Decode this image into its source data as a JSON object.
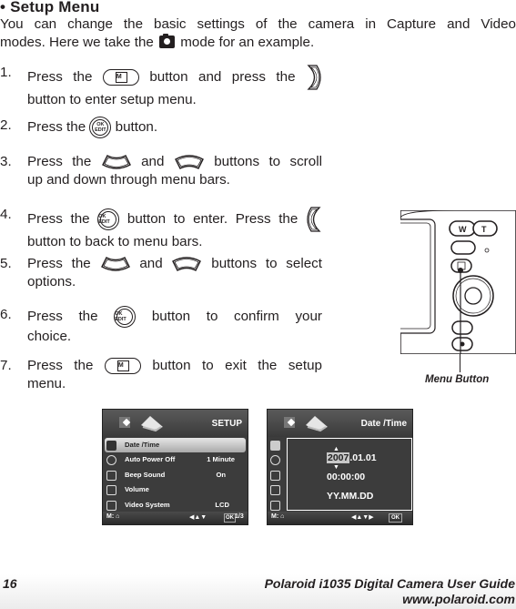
{
  "heading": "• Setup Menu",
  "intro": {
    "line1": "You can change the basic settings of the camera in Capture and Video",
    "line2_before_icon": "modes. Here we take the ",
    "line2_icon": "camera-mode-icon",
    "line2_after_icon": " mode for an example."
  },
  "steps": [
    {
      "num": "1.",
      "parts": [
        "Press the",
        "menu-button-icon",
        "button and press the",
        "flash-right-button-icon"
      ],
      "line2": "button to enter setup menu."
    },
    {
      "num": "2.",
      "parts": [
        "Press the",
        "ok-edit-button-icon",
        "button."
      ]
    },
    {
      "num": "3.",
      "parts": [
        "Press the",
        "self-timer-up-button-icon",
        "and",
        "delete-down-button-icon",
        "buttons to scroll"
      ],
      "line2": "up and down through menu bars."
    },
    {
      "num": "4.",
      "parts": [
        "Press the",
        "ok-edit-button-icon",
        "button to enter. Press the",
        "macro-left-button-icon"
      ],
      "line2": "button to back to menu bars."
    },
    {
      "num": "5.",
      "parts": [
        "Press the",
        "self-timer-up-button-icon",
        "and",
        "delete-down-button-icon",
        "buttons to select"
      ],
      "line2": "options."
    },
    {
      "num": "6.",
      "parts": [
        "Press the",
        "ok-edit-button-icon",
        "button to confirm your"
      ],
      "line2": "choice."
    },
    {
      "num": "7.",
      "parts": [
        "Press the",
        "menu-button-icon",
        "button to exit the setup"
      ],
      "line2": "menu."
    }
  ],
  "icon_text": {
    "ok_top": "OK",
    "ok_bottom": "EDIT"
  },
  "camera_figure": {
    "caption": "Menu Button",
    "buttons": [
      "W",
      "T"
    ]
  },
  "setup_screen": {
    "title": "SETUP",
    "rows": [
      {
        "label": "Date /Time",
        "value": "",
        "selected": true
      },
      {
        "label": "Auto Power Off",
        "value": "1 Minute"
      },
      {
        "label": "Beep Sound",
        "value": "On"
      },
      {
        "label": "Volume",
        "value": ""
      },
      {
        "label": "Video System",
        "value": "LCD"
      }
    ],
    "footer_left": "M: ⌂",
    "footer_nav": "◀▲▼",
    "footer_ok": "OK",
    "footer_page": "1/3"
  },
  "datetime_screen": {
    "title": "Date /Time",
    "year": "2007",
    "date_rest": ".01.01",
    "time": "00:00:00",
    "format": "YY.MM.DD",
    "footer_left": "M: ⌂",
    "footer_nav": "◀▲▼▶",
    "footer_ok": "OK"
  },
  "footer": {
    "page_number": "16",
    "guide_title": "Polaroid i1035 Digital Camera User Guide",
    "website": "www.polaroid.com"
  }
}
